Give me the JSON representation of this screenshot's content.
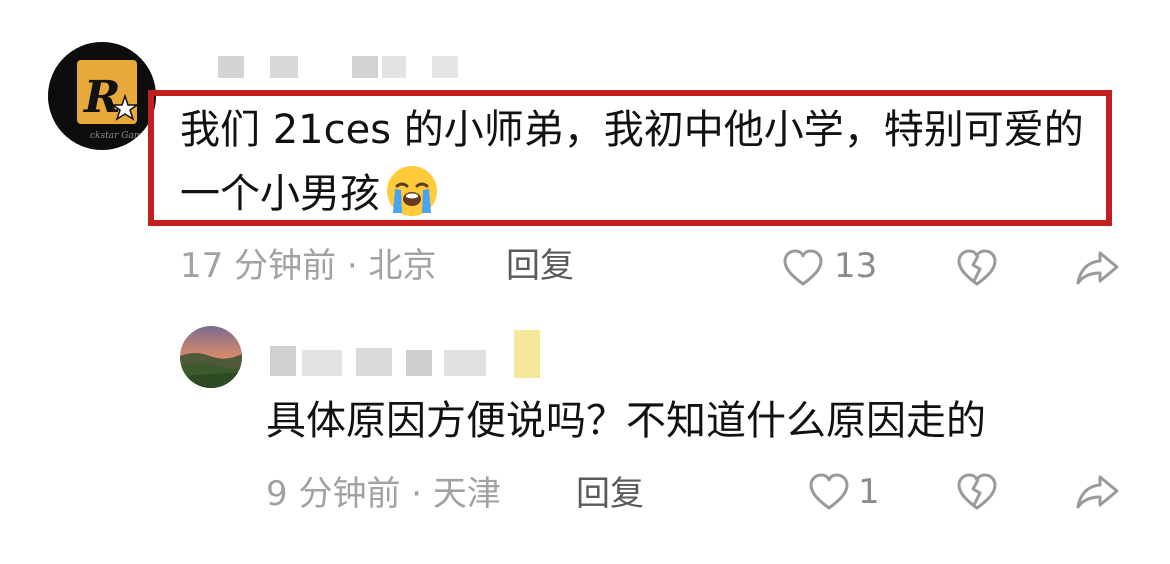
{
  "comments": [
    {
      "text": "我们 21ces 的小师弟，我初中他小学，特别可爱的一个小男孩",
      "emoji": "loudly-crying-face",
      "meta": "17 分钟前 · 北京",
      "reply_label": "回复",
      "likes": "13",
      "highlighted": true,
      "highlight_color": "#c31f1f",
      "avatar_icon": "rockstar-games-logo-icon"
    },
    {
      "text": "具体原因方便说吗？不知道什么原因走的",
      "meta": "9 分钟前 · 天津",
      "reply_label": "回复",
      "likes": "1",
      "highlighted": false,
      "avatar_icon": "landscape-sunset-avatar"
    }
  ],
  "icons": {
    "like": "heart-outline-icon",
    "dislike": "broken-heart-icon",
    "share": "share-arrow-icon"
  },
  "colors": {
    "text": "#111111",
    "meta": "#a2a2a2",
    "action": "#5a5a5a",
    "icon": "#9a9a9a"
  }
}
